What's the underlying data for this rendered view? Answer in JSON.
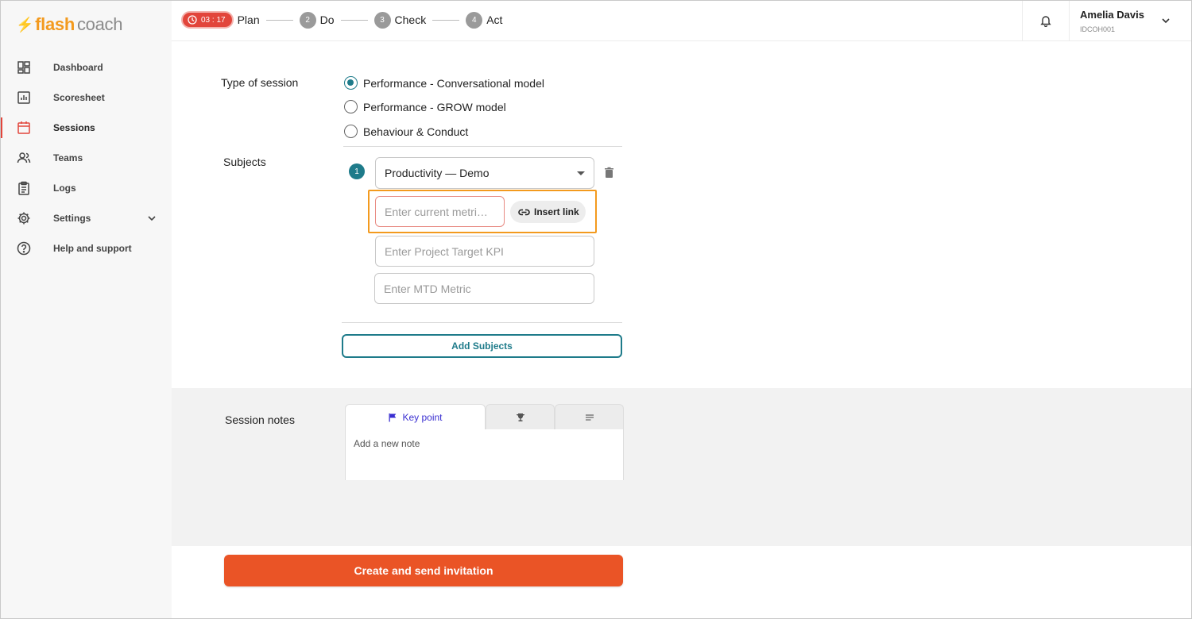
{
  "brand": {
    "flash": "flash",
    "coach": "coach",
    "accent": "#f39a1e"
  },
  "sidebar": {
    "items": [
      {
        "label": "Dashboard",
        "icon": "dashboard-icon"
      },
      {
        "label": "Scoresheet",
        "icon": "chart-icon"
      },
      {
        "label": "Sessions",
        "icon": "calendar-icon",
        "active": true
      },
      {
        "label": "Teams",
        "icon": "people-icon"
      },
      {
        "label": "Logs",
        "icon": "clipboard-icon"
      },
      {
        "label": "Settings",
        "icon": "gear-icon",
        "expandable": true
      },
      {
        "label": "Help and support",
        "icon": "help-icon"
      }
    ]
  },
  "topbar": {
    "timer": "03 : 17",
    "steps": [
      {
        "num": "",
        "label": "Plan"
      },
      {
        "num": "2",
        "label": "Do"
      },
      {
        "num": "3",
        "label": "Check"
      },
      {
        "num": "4",
        "label": "Act"
      }
    ],
    "user": {
      "name": "Amelia Davis",
      "id": "IDCOH001"
    }
  },
  "form": {
    "session_type_label": "Type of session",
    "session_types": [
      {
        "label": "Performance - Conversational model",
        "checked": true
      },
      {
        "label": "Performance - GROW model",
        "checked": false
      },
      {
        "label": "Behaviour & Conduct",
        "checked": false
      }
    ],
    "subjects_label": "Subjects",
    "subject_index": "1",
    "subject_selected": "Productivity — Demo",
    "current_metric_placeholder": "Enter current metri…",
    "insert_link_label": "Insert link",
    "target_kpi_placeholder": "Enter Project Target KPI",
    "mtd_metric_placeholder": "Enter MTD Metric",
    "add_subjects_label": "Add Subjects"
  },
  "notes": {
    "label": "Session notes",
    "tabs": [
      {
        "label": "Key point",
        "icon": "flag-icon",
        "active": true
      },
      {
        "label": "",
        "icon": "trophy-icon"
      },
      {
        "label": "",
        "icon": "lines-icon"
      }
    ],
    "placeholder": "Add a new note"
  },
  "actions": {
    "create_label": "Create and send invitation"
  },
  "colors": {
    "primary": "#1e7b8a",
    "danger": "#e2453b",
    "cta": "#ea5426"
  }
}
